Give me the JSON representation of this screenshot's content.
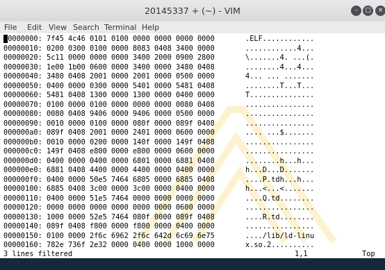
{
  "window": {
    "title": "20145337 + (~) - VIM",
    "buttons": {
      "minimize": "–",
      "maximize": "□",
      "close": "×"
    }
  },
  "menubar": {
    "items": [
      "File",
      "Edit",
      "View",
      "Search",
      "Terminal",
      "Help"
    ]
  },
  "hexdump": {
    "lines": [
      {
        "offset": "00000000:",
        "hex": "7f45 4c46 0101 0100 0000 0000 0000 0000",
        "ascii": ".ELF............"
      },
      {
        "offset": "00000010:",
        "hex": "0200 0300 0100 0000 8083 0408 3400 0000",
        "ascii": "............4..."
      },
      {
        "offset": "00000020:",
        "hex": "5c11 0000 0000 0000 3400 2000 0900 2800",
        "ascii": "\\.......4. ...(."
      },
      {
        "offset": "00000030:",
        "hex": "1e00 1b00 0600 0000 3400 0000 3480 0408",
        "ascii": "........4...4..."
      },
      {
        "offset": "00000040:",
        "hex": "3480 0408 2001 0000 2001 0000 0500 0000",
        "ascii": "4... ... ......."
      },
      {
        "offset": "00000050:",
        "hex": "0400 0000 0300 0000 5401 0000 5481 0408",
        "ascii": "........T...T..."
      },
      {
        "offset": "00000060:",
        "hex": "5481 0408 1300 0000 1300 0000 0400 0000",
        "ascii": "T..............."
      },
      {
        "offset": "00000070:",
        "hex": "0100 0000 0100 0000 0000 0000 0080 0408",
        "ascii": "................"
      },
      {
        "offset": "00000080:",
        "hex": "0080 0408 9406 0000 9406 0000 0500 0000",
        "ascii": "................"
      },
      {
        "offset": "00000090:",
        "hex": "0010 0000 0100 0000 080f 0000 089f 0408",
        "ascii": "................"
      },
      {
        "offset": "000000a0:",
        "hex": "089f 0408 2001 0000 2401 0000 0600 0000",
        "ascii": ".... ...$......."
      },
      {
        "offset": "000000b0:",
        "hex": "0010 0000 0200 0000 140f 0000 149f 0408",
        "ascii": "................"
      },
      {
        "offset": "000000c0:",
        "hex": "149f 0408 e800 0000 e800 0000 0600 0000",
        "ascii": "................"
      },
      {
        "offset": "000000d0:",
        "hex": "0400 0000 0400 0000 6801 0000 6881 0408",
        "ascii": "........h...h..."
      },
      {
        "offset": "000000e0:",
        "hex": "6881 0408 4400 0000 4400 0000 0400 0000",
        "ascii": "h...D...D......."
      },
      {
        "offset": "000000f0:",
        "hex": "0400 0000 50e5 7464 6805 0000 6885 0408",
        "ascii": "....P.tdh...h..."
      },
      {
        "offset": "00000100:",
        "hex": "6885 0408 3c00 0000 3c00 0000 0400 0000",
        "ascii": "h...<...<......."
      },
      {
        "offset": "00000110:",
        "hex": "0400 0000 51e5 7464 0000 0000 0000 0000",
        "ascii": "....Q.td........"
      },
      {
        "offset": "00000120:",
        "hex": "0000 0000 0000 0000 0000 0000 0600 0000",
        "ascii": "................"
      },
      {
        "offset": "00000130:",
        "hex": "1000 0000 52e5 7464 080f 0000 089f 0408",
        "ascii": "....R.td........"
      },
      {
        "offset": "00000140:",
        "hex": "089f 0408 f800 0000 f800 0000 0400 0000",
        "ascii": "................"
      },
      {
        "offset": "00000150:",
        "hex": "0100 0000 2f6c 6962 2f6c 642d 6c69 6e75",
        "ascii": "..../lib/ld-linu"
      },
      {
        "offset": "00000160:",
        "hex": "782e 736f 2e32 0000 0400 0000 1000 0000",
        "ascii": "x.so.2.........."
      }
    ]
  },
  "statusline": {
    "message": "3 lines filtered",
    "position": "1,1",
    "scroll": "Top"
  },
  "colors": {
    "terminal_bg": "#ffffff",
    "text": "#000000",
    "titlebar": "#e3e3e3",
    "desktop": "#1d3550"
  }
}
